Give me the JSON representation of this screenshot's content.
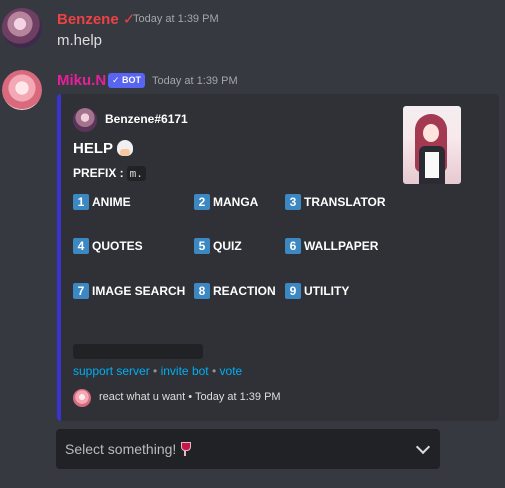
{
  "messages": [
    {
      "author": "Benzene ✓",
      "author_color": "#ed4245",
      "timestamp": "Today at 1:39 PM",
      "content": "m.help"
    },
    {
      "author": "Miku.N",
      "author_color": "#e91e9b",
      "bot_tag": "✓ BOT",
      "timestamp": "Today at 1:39 PM"
    }
  ],
  "embed": {
    "accent_color": "#3a33d1",
    "author": "Benzene#6171",
    "title": "HELP",
    "prefix_label": "PREFIX :",
    "prefix_value": "m.",
    "categories": [
      {
        "num": "1",
        "label": "ANIME"
      },
      {
        "num": "2",
        "label": "MANGA"
      },
      {
        "num": "3",
        "label": "TRANSLATOR"
      },
      {
        "num": "4",
        "label": "QUOTES"
      },
      {
        "num": "5",
        "label": "QUIZ"
      },
      {
        "num": "6",
        "label": "WALLPAPER"
      },
      {
        "num": "7",
        "label": "IMAGE SEARCH"
      },
      {
        "num": "8",
        "label": "REACTION"
      },
      {
        "num": "9",
        "label": "UTILITY"
      }
    ],
    "links": {
      "support": "support server",
      "invite": "invite bot",
      "vote": "vote",
      "separator": "•"
    },
    "footer": "react what u want • Today at 1:39 PM"
  },
  "select_menu": {
    "placeholder": "Select something!",
    "icon": "wine-glass-icon"
  }
}
